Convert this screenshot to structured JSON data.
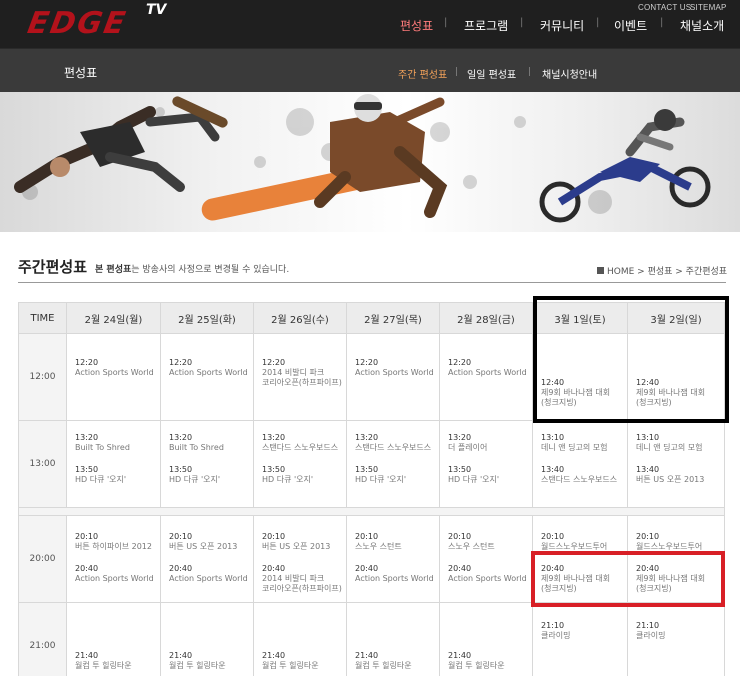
{
  "header": {
    "logo": "EDGE",
    "logo_tv": "TV",
    "util": {
      "contact": "CONTACT US",
      "sitemap": "SITEMAP"
    },
    "nav": [
      {
        "label": "편성표",
        "active": true
      },
      {
        "label": "프로그램",
        "active": false
      },
      {
        "label": "커뮤니티",
        "active": false
      },
      {
        "label": "이벤트",
        "active": false
      },
      {
        "label": "채널소개",
        "active": false
      }
    ]
  },
  "subheader": {
    "title": "편성표",
    "nav": [
      {
        "label": "주간 편성표",
        "active": true
      },
      {
        "label": "일일 편성표",
        "active": false
      },
      {
        "label": "채널시청안내",
        "active": false
      }
    ]
  },
  "page": {
    "title": "주간편성표",
    "note_bold": "본 편성표",
    "note_rest": "는 방송사의 사정으로 변경될 수 있습니다.",
    "breadcrumb": "HOME > 편성표 > 주간편성표"
  },
  "table": {
    "time_header": "TIME",
    "days": [
      "2월 24일(월)",
      "2월 25일(화)",
      "2월 26일(수)",
      "2월 27일(목)",
      "2월 28일(금)",
      "3월 1일(토)",
      "3월 2일(일)"
    ],
    "rows": [
      {
        "time": "12:00",
        "cells": [
          [
            {
              "t": "12:20",
              "n": [
                "Action Sports World"
              ],
              "y": 24
            }
          ],
          [
            {
              "t": "12:20",
              "n": [
                "Action Sports World"
              ],
              "y": 24
            }
          ],
          [
            {
              "t": "12:20",
              "n": [
                "2014 비발디 파크",
                "코리아오픈(하프파이프)"
              ],
              "y": 24
            }
          ],
          [
            {
              "t": "12:20",
              "n": [
                "Action Sports World"
              ],
              "y": 24
            }
          ],
          [
            {
              "t": "12:20",
              "n": [
                "Action Sports World"
              ],
              "y": 24
            }
          ],
          [
            {
              "t": "12:40",
              "n": [
                "제9회 바나나잼 대회",
                "(청크지빙)"
              ],
              "y": 44
            }
          ],
          [
            {
              "t": "12:40",
              "n": [
                "제9회 바나나잼 대회",
                "(청크지빙)"
              ],
              "y": 44
            }
          ]
        ]
      },
      {
        "time": "13:00",
        "cells": [
          [
            {
              "t": "13:20",
              "n": [
                "Built To Shred"
              ],
              "y": 12
            },
            {
              "t": "13:50",
              "n": [
                "HD 다큐 '오지'"
              ],
              "y": 44
            }
          ],
          [
            {
              "t": "13:20",
              "n": [
                "Built To Shred"
              ],
              "y": 12
            },
            {
              "t": "13:50",
              "n": [
                "HD 다큐 '오지'"
              ],
              "y": 44
            }
          ],
          [
            {
              "t": "13:20",
              "n": [
                "스탠다드 스노우보드스"
              ],
              "y": 12
            },
            {
              "t": "13:50",
              "n": [
                "HD 다큐 '오지'"
              ],
              "y": 44
            }
          ],
          [
            {
              "t": "13:20",
              "n": [
                "스탠다드 스노우보드스"
              ],
              "y": 12
            },
            {
              "t": "13:50",
              "n": [
                "HD 다큐 '오지'"
              ],
              "y": 44
            }
          ],
          [
            {
              "t": "13:20",
              "n": [
                "더 플레이어"
              ],
              "y": 12
            },
            {
              "t": "13:50",
              "n": [
                "HD 다큐 '오지'"
              ],
              "y": 44
            }
          ],
          [
            {
              "t": "13:10",
              "n": [
                "데니 앤 딩고의 모험"
              ],
              "y": 12
            },
            {
              "t": "13:40",
              "n": [
                "스탠다드 스노우보드스"
              ],
              "y": 44
            }
          ],
          [
            {
              "t": "13:10",
              "n": [
                "데니 앤 딩고의 모험"
              ],
              "y": 12
            },
            {
              "t": "13:40",
              "n": [
                "버튼 US 오픈 2013"
              ],
              "y": 44
            }
          ]
        ]
      },
      {
        "time": "20:00",
        "cells": [
          [
            {
              "t": "20:10",
              "n": [
                "버튼 하이파이브 2012"
              ],
              "y": 16
            },
            {
              "t": "20:40",
              "n": [
                "Action Sports World"
              ],
              "y": 48
            }
          ],
          [
            {
              "t": "20:10",
              "n": [
                "버튼 US 오픈 2013"
              ],
              "y": 16
            },
            {
              "t": "20:40",
              "n": [
                "Action Sports World"
              ],
              "y": 48
            }
          ],
          [
            {
              "t": "20:10",
              "n": [
                "버튼 US 오픈 2013"
              ],
              "y": 16
            },
            {
              "t": "20:40",
              "n": [
                "2014 비발디 파크",
                "코리아오픈(하프파이프)"
              ],
              "y": 48
            }
          ],
          [
            {
              "t": "20:10",
              "n": [
                "스노우 스턴트"
              ],
              "y": 16
            },
            {
              "t": "20:40",
              "n": [
                "Action Sports World"
              ],
              "y": 48
            }
          ],
          [
            {
              "t": "20:10",
              "n": [
                "스노우 스턴트"
              ],
              "y": 16
            },
            {
              "t": "20:40",
              "n": [
                "Action Sports World"
              ],
              "y": 48
            }
          ],
          [
            {
              "t": "20:10",
              "n": [
                "월드스노우보드투어"
              ],
              "y": 16
            },
            {
              "t": "20:40",
              "n": [
                "제9회 바나나잼 대회",
                "(청크지빙)"
              ],
              "y": 48
            }
          ],
          [
            {
              "t": "20:10",
              "n": [
                "월드스노우보드투어"
              ],
              "y": 16
            },
            {
              "t": "20:40",
              "n": [
                "제9회 바나나잼 대회",
                "(청크지빙)"
              ],
              "y": 48
            }
          ]
        ]
      },
      {
        "time": "21:00",
        "cells": [
          [
            {
              "t": "21:40",
              "n": [
                "월컴 투 힐링타운"
              ],
              "y": 48
            }
          ],
          [
            {
              "t": "21:40",
              "n": [
                "월컴 투 힐링타운"
              ],
              "y": 48
            }
          ],
          [
            {
              "t": "21:40",
              "n": [
                "월컴 투 힐링타운"
              ],
              "y": 48
            }
          ],
          [
            {
              "t": "21:40",
              "n": [
                "월컴 투 힐링타운"
              ],
              "y": 48
            }
          ],
          [
            {
              "t": "21:40",
              "n": [
                "월컴 투 힐링타운"
              ],
              "y": 48
            }
          ],
          [
            {
              "t": "21:10",
              "n": [
                "클라이밍"
              ],
              "y": 18
            }
          ],
          [
            {
              "t": "21:10",
              "n": [
                "클라이밍"
              ],
              "y": 18
            }
          ]
        ]
      }
    ]
  }
}
